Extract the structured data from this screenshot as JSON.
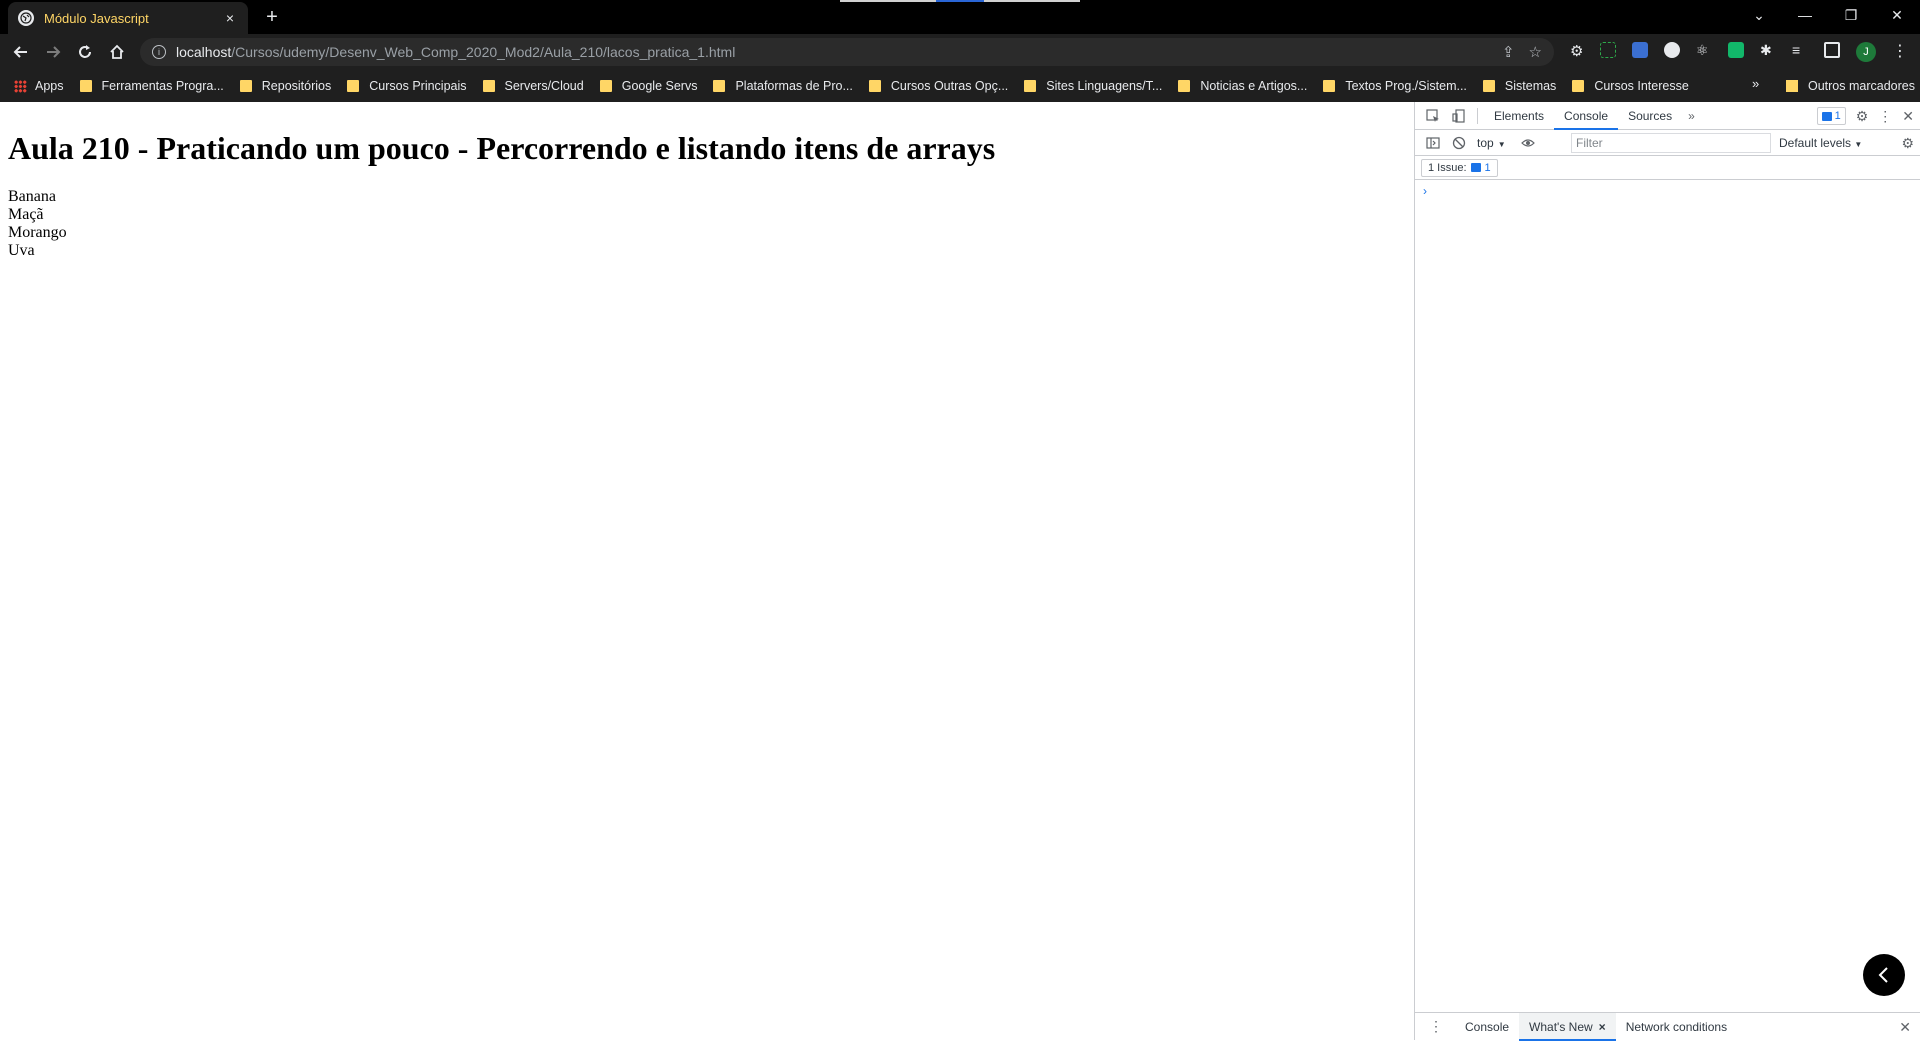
{
  "browser": {
    "tab": {
      "title": "Módulo Javascript",
      "close": "×"
    },
    "new_tab": "+",
    "window_controls": {
      "dropdown": "⌄",
      "minimize": "—",
      "restore": "❐",
      "close": "✕"
    },
    "url": {
      "host": "localhost",
      "path": "/Cursos/udemy/Desenv_Web_Comp_2020_Mod2/Aula_210/lacos_pratica_1.html"
    },
    "profile_initial": "J",
    "bookmarks": [
      "Apps",
      "Ferramentas Progra...",
      "Repositórios",
      "Cursos Principais",
      "Servers/Cloud",
      "Google Servs",
      "Plataformas de Pro...",
      "Cursos Outras Opç...",
      "Sites Linguagens/T...",
      "Noticias e Artigos...",
      "Textos Prog./Sistem...",
      "Sistemas",
      "Cursos Interesse"
    ],
    "bookmarks_overflow": "»",
    "other_bookmarks": "Outros marcadores"
  },
  "page": {
    "heading": "Aula 210 - Praticando um pouco - Percorrendo e listando itens de arrays",
    "items": [
      "Banana",
      "Maçã",
      "Morango",
      "Uva"
    ]
  },
  "devtools": {
    "tabs": [
      "Elements",
      "Console",
      "Sources"
    ],
    "active_tab": "Console",
    "more_tabs": "»",
    "issues_badge_count": "1",
    "context": "top",
    "filter_placeholder": "Filter",
    "levels": "Default levels",
    "issues_label": "1 Issue:",
    "issues_count": "1",
    "prompt": "›",
    "drawer_tabs": [
      "Console",
      "What's New",
      "Network conditions"
    ],
    "drawer_active": "What's New",
    "drawer_close": "×"
  },
  "colors": {
    "tab_title": "#ffd666",
    "chrome_bg": "#1f1f1f",
    "devtools_accent": "#1a73e8"
  }
}
